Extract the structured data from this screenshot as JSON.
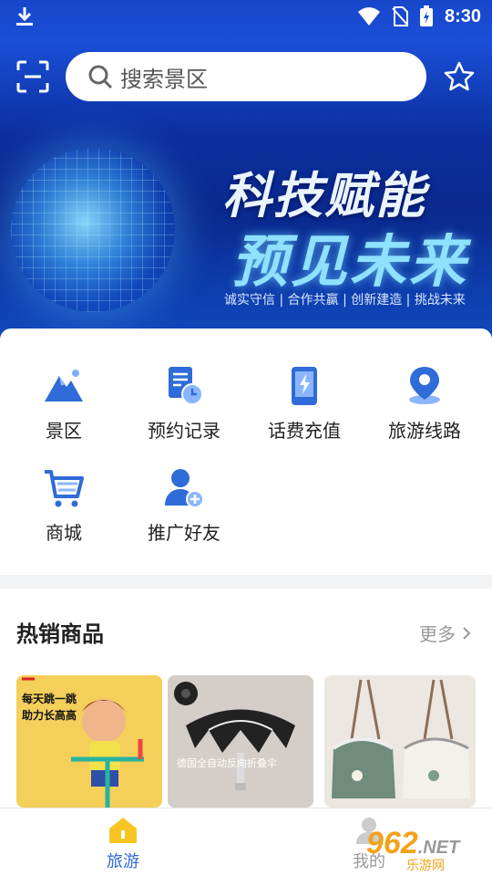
{
  "status_bar": {
    "time": "8:30"
  },
  "search": {
    "placeholder": "搜索景区"
  },
  "banner": {
    "headline": "科技赋能",
    "subheadline": "预见未来",
    "tagline": "诚实守信 | 合作共赢 | 创新建造 | 挑战未来"
  },
  "categories": [
    {
      "label": "景区",
      "icon": "mountain-icon"
    },
    {
      "label": "预约记录",
      "icon": "reservation-record-icon"
    },
    {
      "label": "话费充值",
      "icon": "phone-recharge-icon"
    },
    {
      "label": "旅游线路",
      "icon": "location-pin-icon"
    },
    {
      "label": "商城",
      "icon": "shopping-cart-icon"
    },
    {
      "label": "推广好友",
      "icon": "add-friend-icon"
    }
  ],
  "hot_products": {
    "title": "热销商品",
    "more_label": "更多",
    "items": [
      {
        "image_text": [
          "每天跳一跳",
          "助力长高高"
        ],
        "icon": "pogo-stick-product-image"
      },
      {
        "image_text": [
          "德国全自动反向折叠伞"
        ],
        "icon": "umbrella-product-image"
      },
      {
        "image_text": [],
        "icon": "handbag-product-image"
      }
    ]
  },
  "bottom_nav": {
    "items": [
      {
        "label": "旅游",
        "icon": "home-icon",
        "active": true
      },
      {
        "label": "我的",
        "icon": "user-icon",
        "active": false
      }
    ]
  },
  "watermark": {
    "logo": "962",
    "suffix": ".NET",
    "subtitle": "乐游网"
  },
  "colors": {
    "primary": "#2f6bd9",
    "accent_yellow": "#f7c520",
    "banner_blue": "#0b2f9e"
  }
}
